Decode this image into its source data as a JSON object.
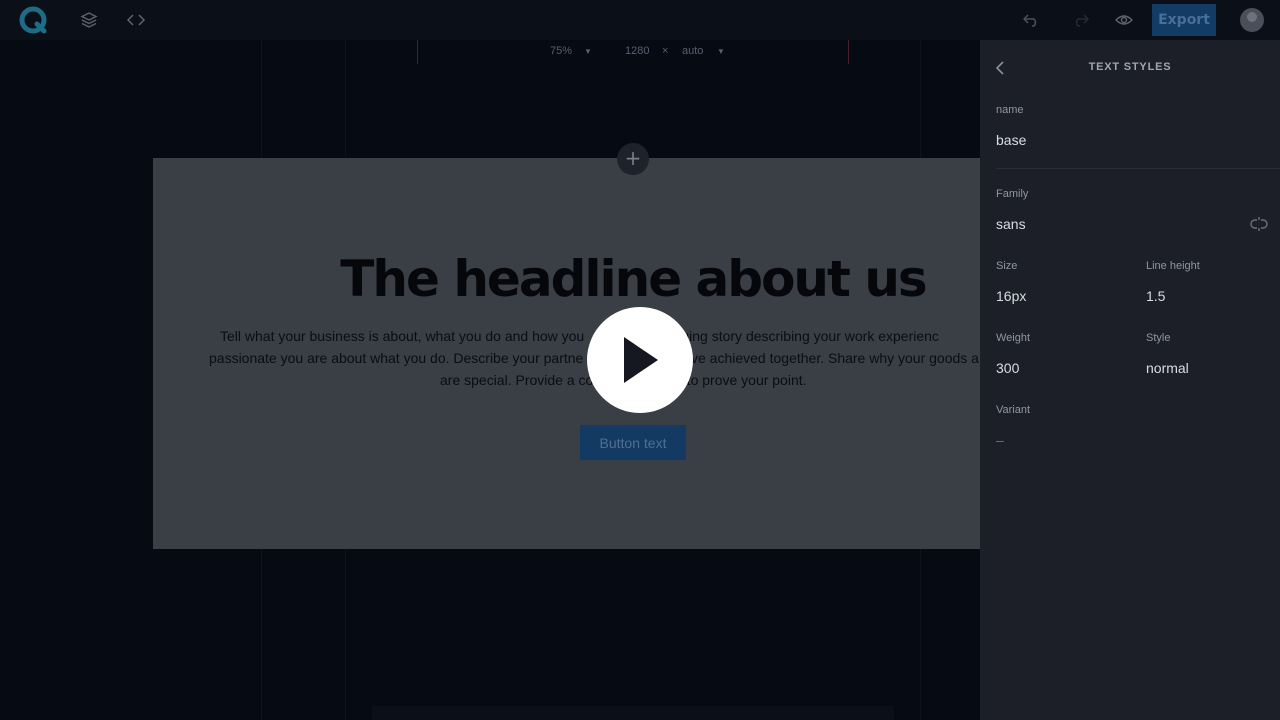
{
  "toolbar": {
    "export_label": "Export"
  },
  "canvas": {
    "zoom": "75%",
    "width": "1280",
    "times": "×",
    "height": "auto"
  },
  "frame": {
    "add_symbol": "+",
    "headline": "The headline about us",
    "body_line1": "Tell what your business is about, what you do and how you",
    "body_line1b": "ngaging story describing your work experienc",
    "body_line2a": "passionate you are about what you do. Describe your partne",
    "body_line2b": "wh",
    "body_line2c": "ve achieved together. Share why your goods a",
    "body_line3a": "are special. Provide a co",
    "body_line3b": "es to prove your point.",
    "button_label": "Button text"
  },
  "panel": {
    "title": "TEXT STYLES",
    "name_label": "name",
    "name_value": "base",
    "family_label": "Family",
    "family_value": "sans",
    "size_label": "Size",
    "size_value": "16px",
    "line_height_label": "Line height",
    "line_height_value": "1.5",
    "weight_label": "Weight",
    "weight_value": "300",
    "style_label": "Style",
    "style_value": "normal",
    "variant_label": "Variant",
    "variant_value": "–"
  },
  "colors": {
    "accent": "#1e6ab8",
    "panel_bg": "#1c1f27",
    "canvas_bg": "#060a12"
  },
  "icons": [
    "logo-icon",
    "layers-icon",
    "code-icon",
    "undo-icon",
    "redo-icon",
    "eye-icon",
    "back-icon",
    "link-icon",
    "play-icon"
  ]
}
